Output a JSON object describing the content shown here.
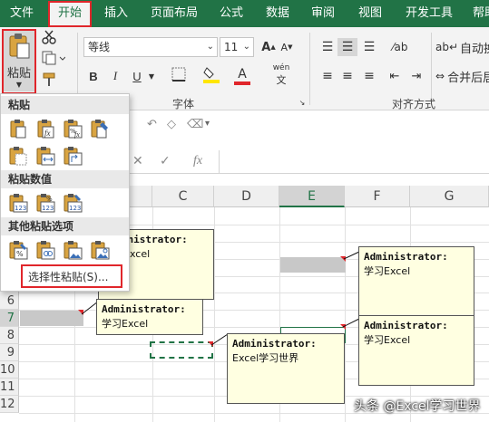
{
  "tabs": [
    {
      "label": "文件",
      "active": false
    },
    {
      "label": "开始",
      "active": true
    },
    {
      "label": "插入",
      "active": false
    },
    {
      "label": "页面布局",
      "active": false
    },
    {
      "label": "公式",
      "active": false
    },
    {
      "label": "数据",
      "active": false
    },
    {
      "label": "审阅",
      "active": false
    },
    {
      "label": "视图",
      "active": false
    },
    {
      "label": "开发工具",
      "active": false
    },
    {
      "label": "帮助",
      "active": false
    }
  ],
  "ribbon": {
    "paste_label": "粘贴",
    "font_name": "等线",
    "font_size": "11",
    "bold": "B",
    "italic": "I",
    "underline": "U",
    "font_color_glyph": "A",
    "phonetic_glyph": "wén",
    "font_group_label": "字体",
    "align_group_label": "对齐方式",
    "wrap_text": "自动换行",
    "merge_center": "合并后居中"
  },
  "formula_bar": {
    "fx": "fx",
    "value": ""
  },
  "paste_menu": {
    "header_paste": "粘贴",
    "header_values": "粘贴数值",
    "header_other": "其他粘贴选项",
    "paste_special": "选择性粘贴(S)..."
  },
  "columns": [
    "C",
    "D",
    "E",
    "F",
    "G"
  ],
  "selected_column": "E",
  "rows": [
    "6",
    "7",
    "8",
    "9",
    "10",
    "11",
    "12"
  ],
  "selected_row": "7",
  "comments": [
    {
      "author": "Administrator:",
      "text": "学习Excel"
    },
    {
      "author": "Administrator:",
      "text": "学习Excel"
    },
    {
      "author": "Administrator:",
      "text": "学习Excel"
    },
    {
      "author": "Administrator:",
      "text": "Excel学习世界"
    },
    {
      "author": "Administrator:",
      "text": "学习Excel"
    }
  ],
  "watermark": "头条 @Excel学习世界",
  "colors": {
    "ribbon_green": "#217346",
    "highlight_red": "#e0262b",
    "comment_bg": "#ffffe1"
  },
  "icons": [
    "scissors-icon",
    "copy-icon",
    "format-painter-icon",
    "paste-icon",
    "fill-color-icon",
    "font-color-icon",
    "align-icons",
    "wrap-text-icon",
    "merge-icon"
  ]
}
